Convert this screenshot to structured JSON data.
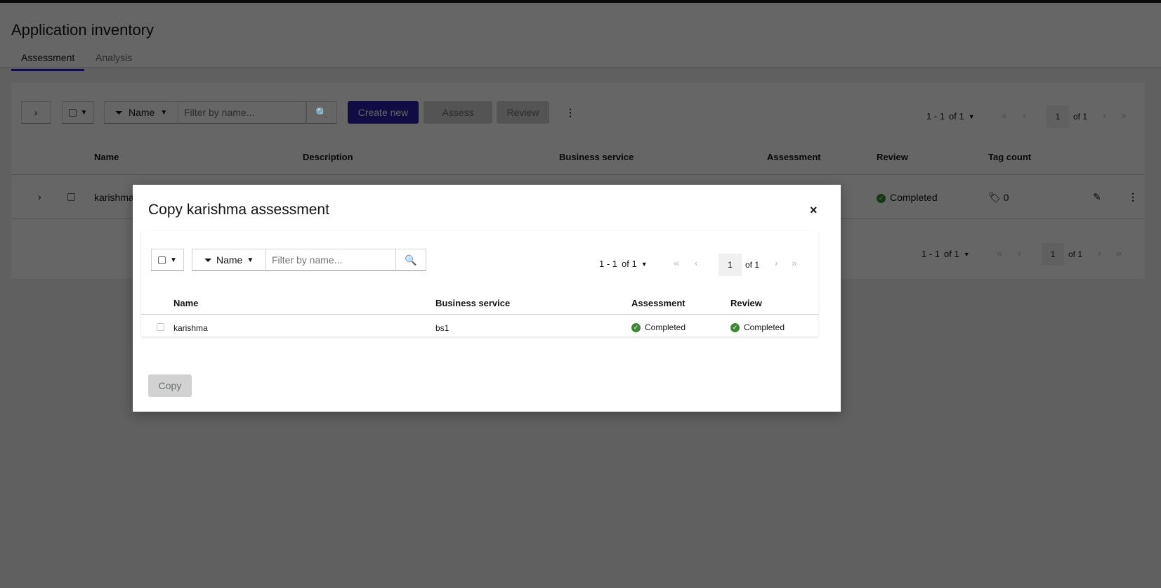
{
  "page": {
    "title": "Application inventory",
    "tabs": [
      {
        "label": "Assessment"
      },
      {
        "label": "Analysis"
      }
    ]
  },
  "toolbar": {
    "filter_label": "Name",
    "filter_placeholder": "Filter by name...",
    "create_label": "Create new",
    "assess_label": "Assess",
    "review_label": "Review"
  },
  "pagination": {
    "range": "1 - 1",
    "of_total": "of 1",
    "page": "1",
    "of_pages": "of 1"
  },
  "table": {
    "headers": [
      "Name",
      "Description",
      "Business service",
      "Assessment",
      "Review",
      "Tag count"
    ],
    "rows": [
      {
        "name": "karishma",
        "review": "Completed",
        "tag_count": "0"
      }
    ]
  },
  "modal": {
    "title": "Copy karishma assessment",
    "close": "×",
    "filter_label": "Name",
    "filter_placeholder": "Filter by name...",
    "pagination": {
      "range": "1 - 1",
      "of_total": "of 1",
      "page": "1",
      "of_pages": "of 1"
    },
    "headers": [
      "Name",
      "Business service",
      "Assessment",
      "Review"
    ],
    "rows": [
      {
        "name": "karishma",
        "business_service": "bs1",
        "assessment": "Completed",
        "review": "Completed"
      }
    ],
    "copy_label": "Copy"
  },
  "colors": {
    "primary": "#2b1ea8",
    "success": "#3e8635"
  }
}
